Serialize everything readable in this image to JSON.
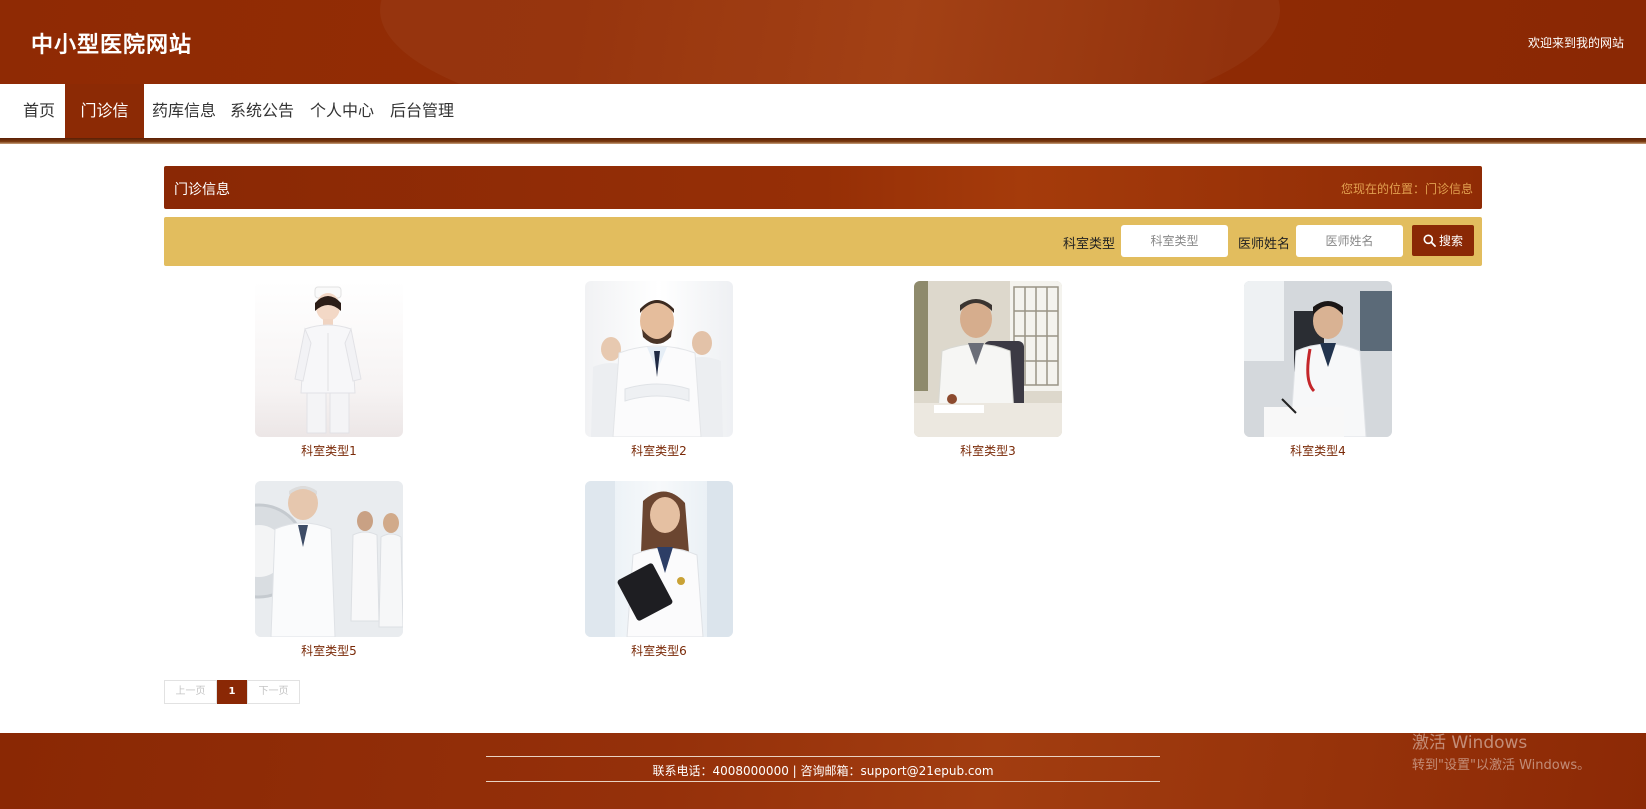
{
  "header": {
    "site_title": "中小型医院网站",
    "welcome": "欢迎来到我的网站"
  },
  "nav": {
    "items": [
      {
        "label": "首页",
        "active": false
      },
      {
        "label": "门诊信息",
        "active": true
      },
      {
        "label": "药库信息",
        "active": false
      },
      {
        "label": "系统公告",
        "active": false
      },
      {
        "label": "个人中心",
        "active": false
      },
      {
        "label": "后台管理",
        "active": false
      }
    ]
  },
  "page": {
    "title": "门诊信息",
    "location": "您现在的位置：门诊信息"
  },
  "search": {
    "dept_label": "科室类型",
    "dept_placeholder": "科室类型",
    "doctor_label": "医师姓名",
    "doctor_placeholder": "医师姓名",
    "button_label": "搜索"
  },
  "cards": [
    {
      "label": "科室类型1",
      "image": "nurse-photo"
    },
    {
      "label": "科室类型2",
      "image": "doctors-group-photo"
    },
    {
      "label": "科室类型3",
      "image": "senior-doctor-desk-photo"
    },
    {
      "label": "科室类型4",
      "image": "doctor-writing-photo"
    },
    {
      "label": "科室类型5",
      "image": "doctors-scanner-photo"
    },
    {
      "label": "科室类型6",
      "image": "female-doctor-clipboard-photo"
    }
  ],
  "pager": {
    "prev": "上一页",
    "current": "1",
    "next": "下一页"
  },
  "footer": {
    "contact": "联系电话：4008000000 | 咨询邮箱：support@21epub.com"
  },
  "watermark": {
    "line1": "激活 Windows",
    "line2": "转到\"设置\"以激活 Windows。"
  },
  "colors": {
    "brand": "#8c2a05",
    "search_bg": "#e2bd5e",
    "location_text": "#e2a050"
  }
}
